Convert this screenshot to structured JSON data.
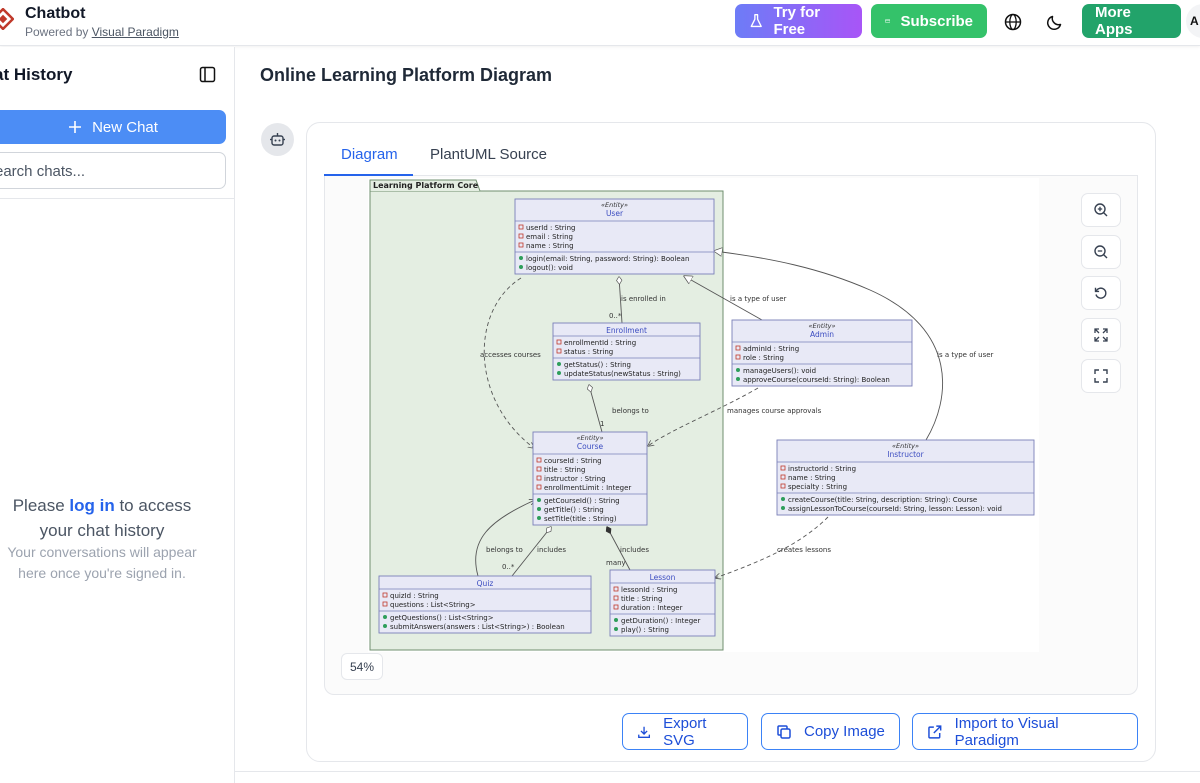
{
  "app": {
    "title": "Chatbot",
    "powered_prefix": "Powered by ",
    "powered_link": "Visual Paradigm"
  },
  "topbar": {
    "try_label": "Try for Free",
    "subscribe_label": "Subscribe",
    "more_apps_label": "More Apps",
    "avatar_letter": "A"
  },
  "sidebar": {
    "title": "at History",
    "new_chat_label": "New Chat",
    "search_placeholder": "earch chats...",
    "login_prefix": "Please ",
    "login_link": "log in",
    "login_suffix": " to access your chat history",
    "login_sub": "Your conversations will appear here once you're signed in."
  },
  "main": {
    "title": "Online Learning Platform Diagram",
    "tabs": [
      "Diagram",
      "PlantUML Source"
    ],
    "zoom_level": "54%",
    "actions": [
      "Export SVG",
      "Copy Image",
      "Import to Visual Paradigm"
    ]
  },
  "diagram": {
    "package": "Learning Platform Core",
    "stereotype": "«Entity»",
    "classes": {
      "user": {
        "name": "User",
        "attrs": [
          "userId : String",
          "email : String",
          "name : String"
        ],
        "methods": [
          "login(email: String, password: String): Boolean",
          "logout(): void"
        ]
      },
      "enrollment": {
        "name": "Enrollment",
        "attrs": [
          "enrollmentId : String",
          "status : String"
        ],
        "methods": [
          "getStatus() : String",
          "updateStatus(newStatus : String)"
        ]
      },
      "admin": {
        "name": "Admin",
        "attrs": [
          "adminId : String",
          "role : String"
        ],
        "methods": [
          "manageUsers(): void",
          "approveCourse(courseId: String): Boolean"
        ]
      },
      "course": {
        "name": "Course",
        "attrs": [
          "courseId : String",
          "title : String",
          "instructor : String",
          "enrollmentLimit : Integer"
        ],
        "methods": [
          "getCourseId() : String",
          "getTitle() : String",
          "setTitle(title : String)"
        ]
      },
      "instructor": {
        "name": "Instructor",
        "attrs": [
          "instructorId : String",
          "name : String",
          "specialty : String"
        ],
        "methods": [
          "createCourse(title: String, description: String): Course",
          "assignLessonToCourse(courseId: String, lesson: Lesson): void"
        ]
      },
      "quiz": {
        "name": "Quiz",
        "attrs": [
          "quizId : String",
          "questions : List<String>"
        ],
        "methods": [
          "getQuestions() : List<String>",
          "submitAnswers(answers : List<String>) : Boolean"
        ]
      },
      "lesson": {
        "name": "Lesson",
        "attrs": [
          "lessonId : String",
          "title : String",
          "duration : Integer"
        ],
        "methods": [
          "getDuration() : Integer",
          "play() : String"
        ]
      }
    },
    "labels": {
      "is_enrolled_in": "is enrolled in",
      "mult_0n": "0..*",
      "is_a_type_of_user": "is a type of user",
      "accesses_courses": "accesses courses",
      "belongs_to": "belongs to",
      "mult_1": "1",
      "manages_course_approvals": "manages course approvals",
      "includes": "includes",
      "many": "many",
      "creates_lessons": "creates lessons"
    }
  },
  "colors": {
    "primary": "#2563eb",
    "new_chat": "#4c8df5",
    "subscribe": "#34c26a",
    "more_apps": "#22a36a",
    "package_fill": "#e4eee2",
    "class_fill": "#e8e9f6",
    "class_border": "#7a7fb8"
  }
}
